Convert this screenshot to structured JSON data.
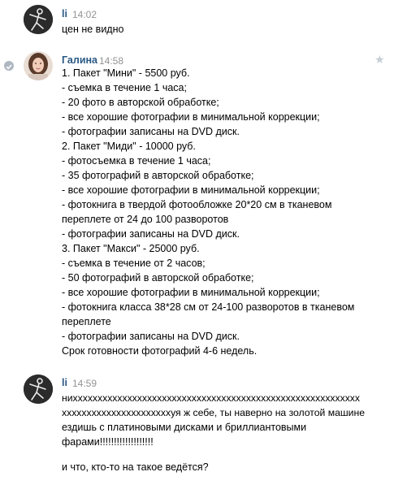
{
  "messages": [
    {
      "sender": "li",
      "time": "14:02",
      "lines": [
        "цен не видно"
      ]
    },
    {
      "sender": "Галина",
      "time": "14:58",
      "lines": [
        "1. Пакет \"Мини\" - 5500 руб.",
        "- съемка в течение 1 часа;",
        "- 20 фото в авторской обработке;",
        "- все хорошие фотографии в минимальной коррекции;",
        "- фотографии записаны на DVD диск.",
        "2. Пакет \"Миди\" - 10000 руб.",
        "- фотосъемка в течение 1 часа;",
        "- 35 фотографий в авторской обработке;",
        "- все хорошие фотографии в минимальной коррекции;",
        "- фотокнига в твердой фотообложке 20*20 см в тканевом",
        "переплете от 24 до 100 разворотов",
        "- фотографии записаны на DVD диск.",
        "3. Пакет \"Макси\" - 25000 руб.",
        "- съемка в течение от 2 часов;",
        "- 50 фотографий в авторской обработке;",
        "- все хорошие фотографии в минимальной коррекции;",
        "- фотокнига класса 38*28 см от 24-100 разворотов в тканевом",
        "переплете",
        "- фотографии записаны на DVD диск.",
        "Срок готовности фотографий 4-6 недель."
      ]
    },
    {
      "sender": "li",
      "time": "14:59",
      "lines": [
        "нихххххххххххххххххххххххххххххххххххххххххххххххххххххххххх",
        "ххххххххххххххххххххххуя ж себе, ты наверно на золотой машине",
        "ездишь с платиновыми дисками и бриллиантовыми",
        "фарами!!!!!!!!!!!!!!!!!!!",
        "",
        "и что, кто-то на такое ведётся?"
      ]
    }
  ],
  "colors": {
    "sender": "#2a5885",
    "time": "#939393",
    "unread_dot": "#aeb7c2",
    "star": "#c5cdd6"
  },
  "icons": {
    "star": "★",
    "read_status": "read-status-icon"
  }
}
